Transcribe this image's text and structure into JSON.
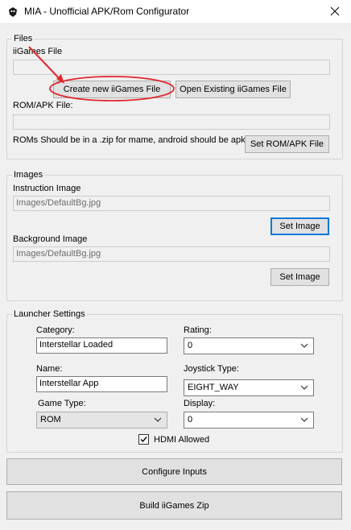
{
  "window": {
    "title": "MIA - Unofficial APK/Rom Configurator"
  },
  "files": {
    "legend": "Files",
    "iigames_label": "iiGames File",
    "iigames_value": "",
    "create_button": "Create new iiGames File",
    "open_button": "Open Existing iiGames File",
    "rom_label": "ROM/APK File:",
    "rom_value": "",
    "hint": "ROMs Should be in a .zip for mame, android should be apk.",
    "set_rom_button": "Set ROM/APK File"
  },
  "images": {
    "legend": "Images",
    "instruction_label": "Instruction Image",
    "instruction_value": "Images/DefaultBg.jpg",
    "set_instruction_button": "Set Image",
    "background_label": "Background Image",
    "background_value": "Images/DefaultBg.jpg",
    "set_background_button": "Set Image"
  },
  "launcher": {
    "legend": "Launcher Settings",
    "category_label": "Category:",
    "category_value": "Interstellar Loaded",
    "rating_label": "Rating:",
    "rating_value": "0",
    "name_label": "Name:",
    "name_value": "Interstellar App",
    "joystick_label": "Joystick Type:",
    "joystick_value": "EIGHT_WAY",
    "game_type_label": "Game Type:",
    "game_type_value": "ROM",
    "display_label": "Display:",
    "display_value": "0",
    "hdmi_label": "HDMI Allowed",
    "hdmi_checked": true
  },
  "actions": {
    "configure_inputs": "Configure Inputs",
    "build_zip": "Build iiGames Zip"
  },
  "icons": {
    "app": "app-icon",
    "close": "close-icon",
    "dropdown": "chevron-down-icon",
    "check": "checkmark-icon"
  },
  "colors": {
    "annotation": "#e0282e",
    "focus": "#0078d7",
    "window_bg": "#f0f0f0"
  }
}
